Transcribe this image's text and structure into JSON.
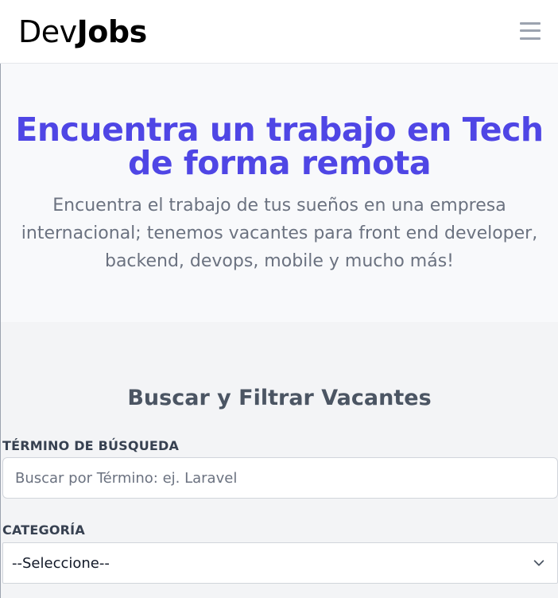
{
  "navbar": {
    "logo_light": "Dev",
    "logo_bold": "Jobs",
    "menu_icon": "hamburger-menu-icon"
  },
  "hero": {
    "title_line1": "Encuentra un trabajo en Tech",
    "title_line2": "de forma remota",
    "subtitle_line1": "Encuentra el trabajo de tus sueños en una empresa",
    "subtitle_line2": "internacional; tenemos vacantes para front end developer,",
    "subtitle_line3": "backend, devops, mobile y mucho más!"
  },
  "search": {
    "heading": "Buscar y Filtrar Vacantes",
    "term_label": "TÉRMINO DE BÚSQUEDA",
    "term_placeholder": "Buscar por Término: ej. Laravel",
    "term_value": "",
    "category_label": "CATEGORÍA",
    "category_selected": "--Seleccione--",
    "category_icon": "chevron-down-icon"
  },
  "colors": {
    "accent": "#4f46e5",
    "hero_bg": "#f8f9fb",
    "search_bg": "#f3f4f6",
    "heading_gray": "#4b5563",
    "body_gray": "#6b7280"
  }
}
